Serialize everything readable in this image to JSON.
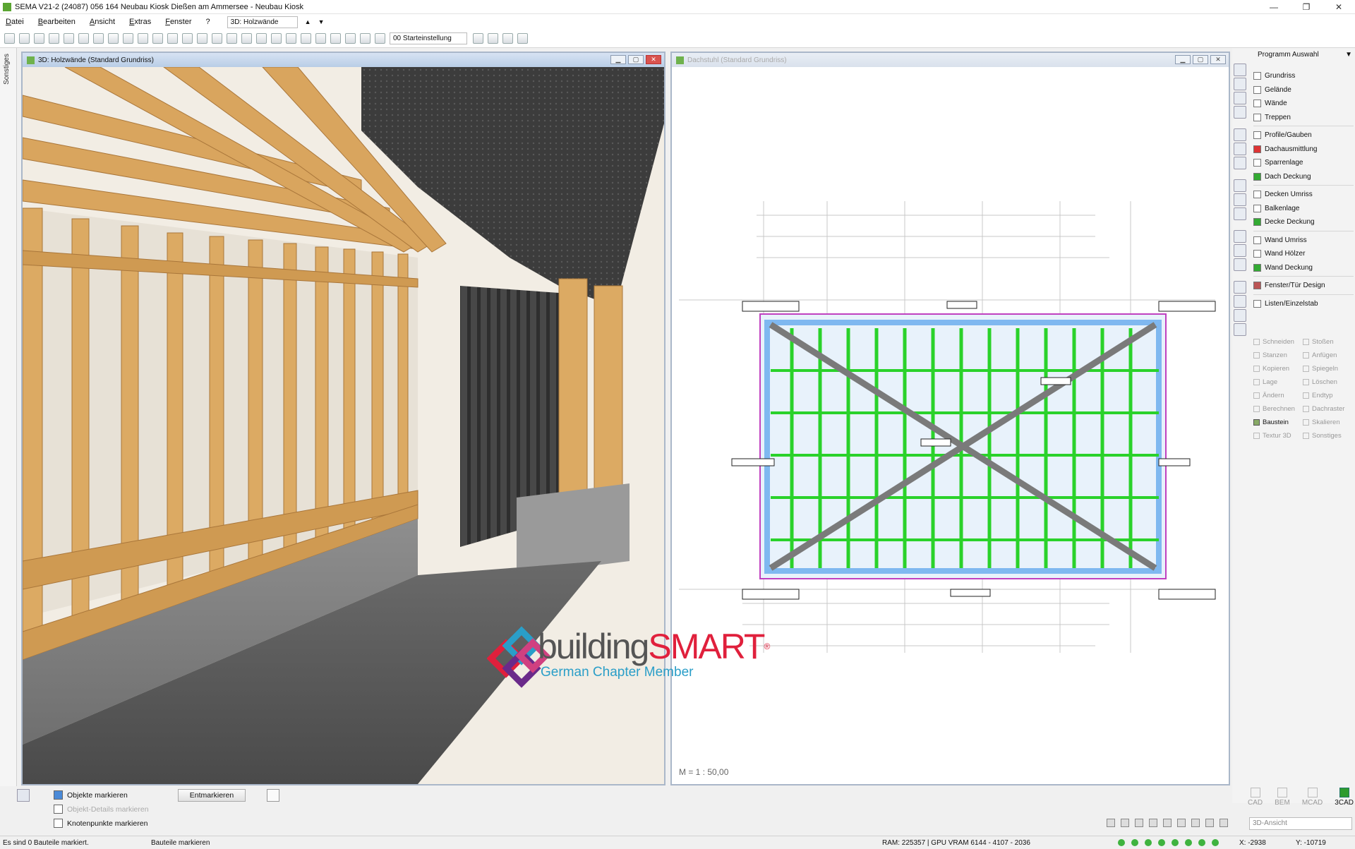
{
  "app": {
    "title": "SEMA V21-2 (24087) 056 164 Neubau Kiosk  Dießen am Ammersee - Neubau Kiosk",
    "window_controls": [
      "—",
      "❐",
      "✕"
    ]
  },
  "menu": {
    "items": [
      "Datei",
      "Bearbeiten",
      "Ansicht",
      "Extras",
      "Fenster",
      "?"
    ],
    "view_combo": "3D: Holzwände"
  },
  "toolbar": {
    "start_setting": "00 Starteinstellung"
  },
  "left_tab": "Sonstiges",
  "view3d": {
    "title": "3D: Holzwände (Standard Grundriss)"
  },
  "view2d": {
    "title": "Dachstuhl (Standard Grundriss)",
    "scale": "M = 1 : 50,00"
  },
  "logo": {
    "brand_light": "building",
    "brand_bold": "SMART",
    "registered": "®",
    "subtitle": "German Chapter Member"
  },
  "right_panel": {
    "program_label": "Programm Auswahl",
    "groups": [
      [
        "Grundriss",
        "Gelände",
        "Wände",
        "Treppen"
      ],
      [
        "Profile/Gauben",
        "Dachausmittlung",
        "Sparrenlage",
        "Dach Deckung"
      ],
      [
        "Decken Umriss",
        "Balkenlage",
        "Decke Deckung"
      ],
      [
        "Wand Umriss",
        "Wand Hölzer",
        "Wand Deckung"
      ],
      [
        "Fenster/Tür Design"
      ],
      [
        "Listen/Einzelstab"
      ]
    ],
    "tools": [
      "Schneiden",
      "Stoßen",
      "Stanzen",
      "Anfügen",
      "Kopieren",
      "Spiegeln",
      "Lage",
      "Löschen",
      "Ändern",
      "Endtyp",
      "Berechnen",
      "Dachraster",
      "Baustein",
      "Skalieren",
      "Textur 3D",
      "Sonstiges"
    ],
    "active_tool": "Baustein",
    "modes": [
      "CAD",
      "BEM",
      "MCAD",
      "3CAD"
    ],
    "active_mode": "3CAD",
    "view_combo": "3D-Ansicht"
  },
  "bottom_panel": {
    "options": [
      "Objekte markieren",
      "Objekt-Details markieren",
      "Knotenpunkte markieren"
    ],
    "unmark_button": "Entmarkieren"
  },
  "status": {
    "left": "Es sind 0 Bauteile markiert.",
    "mode": "Bauteile markieren",
    "memory": "RAM: 225357 | GPU VRAM 6144 - 4107 - 2036",
    "x": "X: -2938",
    "y": "Y: -10719"
  },
  "colors": {
    "wood": "#d9a55e",
    "panel_dark": "#3b3b3b",
    "plan_green": "#2ad22a",
    "plan_magenta": "#c040c0",
    "plan_blue": "#7fb8f0",
    "brand_red": "#e0203c",
    "brand_purple": "#6a2a8a",
    "brand_teal": "#2a9ec8"
  }
}
